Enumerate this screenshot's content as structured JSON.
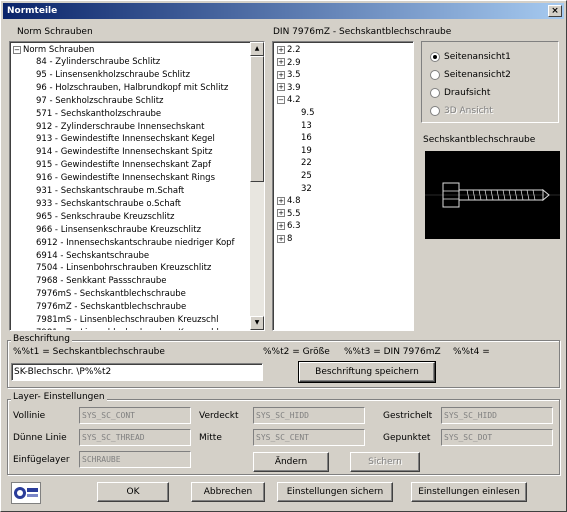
{
  "window": {
    "title": "Normteile",
    "close": "×"
  },
  "left_list": {
    "heading": "Norm Schrauben",
    "root": "Norm Schrauben",
    "items": [
      "84 - Zylinderschraube Schlitz",
      "95 - Linsensenkholzschraube Schlitz",
      "96 - Holzschrauben, Halbrundkopf mit Schlitz",
      "97 - Senkholzschraube Schlitz",
      "571 - Sechskantholzschraube",
      "912 - Zylinderschraube Innensechskant",
      "913 - Gewindestifte Innensechskant Kegel",
      "914 - Gewindestifte Innensechskant Spitz",
      "915 - Gewindestifte Innensechskant Zapf",
      "916 - Gewindestifte Innensechskant Rings",
      "931 - Sechskantschraube m.Schaft",
      "933 - Sechskantschraube o.Schaft",
      "965 - Senkschraube Kreuzschlitz",
      "966 - Linsensenkschraube Kreuzschlitz",
      "6912 - Innensechskantschraube niedriger Kopf",
      "6914 - Sechskantschraube",
      "7504 - Linsenbohrschrauben Kreuzschlitz",
      "7968 - Senkkant Passschraube",
      "7976mS - Sechskantblechschraube",
      "7976mZ - Sechskantblechschraube",
      "7981mS - Linsenblechschrauben Kreuzschl",
      "7981mZ - Linsenblechschrauben Kreuzschl"
    ]
  },
  "mid_list": {
    "heading": "DIN 7976mZ - Sechskantblechschraube",
    "items": [
      {
        "label": "2.2",
        "expander": "+"
      },
      {
        "label": "2.9",
        "expander": "+"
      },
      {
        "label": "3.5",
        "expander": "+"
      },
      {
        "label": "3.9",
        "expander": "+"
      },
      {
        "label": "4.2",
        "expander": "-"
      },
      {
        "label": "9.5",
        "expander": ""
      },
      {
        "label": "13",
        "expander": ""
      },
      {
        "label": "16",
        "expander": ""
      },
      {
        "label": "19",
        "expander": ""
      },
      {
        "label": "22",
        "expander": ""
      },
      {
        "label": "25",
        "expander": ""
      },
      {
        "label": "32",
        "expander": ""
      },
      {
        "label": "4.8",
        "expander": "+"
      },
      {
        "label": "5.5",
        "expander": "+"
      },
      {
        "label": "6.3",
        "expander": "+"
      },
      {
        "label": "8",
        "expander": "+"
      }
    ]
  },
  "views": {
    "options": [
      "Seitenansicht1",
      "Seitenansicht2",
      "Draufsicht",
      "3D Ansicht"
    ],
    "selected": "Seitenansicht1"
  },
  "preview": {
    "title": "Sechskantblechschraube"
  },
  "beschriftung": {
    "group": "Beschriftung",
    "t1": "%%t1 =   Sechskantblechschraube",
    "t2": "%%t2 = Größe",
    "t3": "%%t3 =  DIN 7976mZ",
    "t4": "%%t4 =",
    "input_value": "SK-Blechschr. \\P%%t2",
    "save_button": "Beschriftung speichern"
  },
  "layer": {
    "group": "Layer- Einstellungen",
    "rows": [
      {
        "label1": "Vollinie",
        "value1": "SYS_SC_CONT",
        "label2": "Verdeckt",
        "value2": "SYS_SC_HIDD",
        "label3": "Gestrichelt",
        "value3": "SYS_SC_HIDD"
      },
      {
        "label1": "Dünne Linie",
        "value1": "SYS_SC_THREAD",
        "label2": "Mitte",
        "value2": "SYS_SC_CENT",
        "label3": "Gepunktet",
        "value3": "SYS_SC_DOT"
      }
    ],
    "einfuege_label": "Einfügelayer",
    "einfuege_value": "SCHRAUBE",
    "change_button": "Ändern",
    "save_button": "Sichern"
  },
  "footer": {
    "ok": "OK",
    "cancel": "Abbrechen",
    "save_settings": "Einstellungen sichern",
    "load_settings": "Einstellungen einlesen"
  }
}
